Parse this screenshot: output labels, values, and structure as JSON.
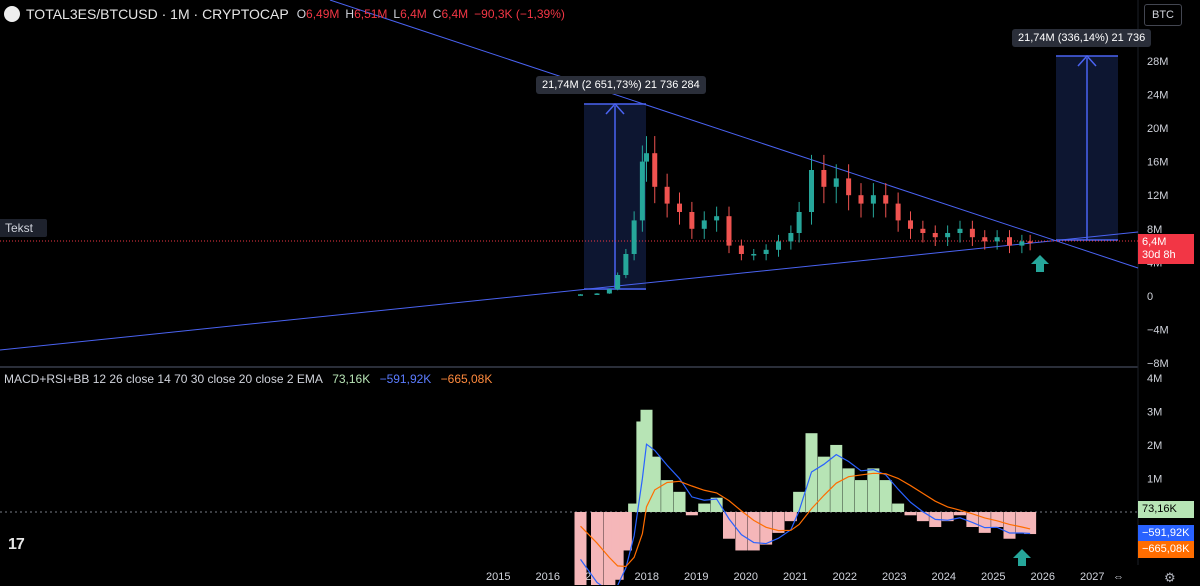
{
  "header": {
    "symbol": "TOTAL3ES/BTCUSD · 1M · CRYPTOCAP",
    "o_key": "O",
    "o_val": "6,49M",
    "h_key": "H",
    "h_val": "6,51M",
    "l_key": "L",
    "l_val": "6,4M",
    "c_key": "C",
    "c_val": "6,4M",
    "change": "−90,3K (−1,39%)"
  },
  "currency_button": "BTC",
  "drawing_label": "Tekst",
  "measure_left": "21,74M (2 651,73%) 21 736 284",
  "measure_right": "21,74M (336,14%) 21 736",
  "price_label": {
    "value": "6,4M",
    "countdown": "30d 8h"
  },
  "price_axis": [
    "28M",
    "24M",
    "20M",
    "16M",
    "12M",
    "8M",
    "4M",
    "0",
    "−4M",
    "−8M"
  ],
  "macd": {
    "name": "MACD+RSI+BB 12 26 close 14 70 30 close 20 close 2 EMA",
    "v1": "73,16K",
    "v2": "−591,92K",
    "v3": "−665,08K",
    "axis": [
      "4M",
      "3M",
      "2M",
      "1M"
    ]
  },
  "time_axis": [
    "2015",
    "2016",
    "2017",
    "2018",
    "2019",
    "2020",
    "2021",
    "2022",
    "2023",
    "2024",
    "2025",
    "2026",
    "2027"
  ],
  "range_icon": "calendar-range-icon",
  "settings_icon": "gear-icon",
  "logo": "tradingview-logo",
  "colors": {
    "up": "#26a69a",
    "down": "#ef5350",
    "trend": "#4a63f2",
    "macd_line": "#2962ff",
    "signal_line": "#ff6d00",
    "hist_up": "#b7e4b5",
    "hist_down": "#f5b7b9",
    "price": "#f23645"
  },
  "chart_data": {
    "type": "candlestick",
    "series": [
      {
        "name": "TOTAL3ES/BTCUSD",
        "x": [
          "2016-09",
          "2017-01",
          "2017-04",
          "2017-06",
          "2017-08",
          "2017-10",
          "2017-12",
          "2018-01",
          "2018-03",
          "2018-06",
          "2018-09",
          "2018-12",
          "2019-03",
          "2019-06",
          "2019-09",
          "2019-12",
          "2020-03",
          "2020-06",
          "2020-09",
          "2020-12",
          "2021-02",
          "2021-05",
          "2021-08",
          "2021-11",
          "2022-02",
          "2022-05",
          "2022-08",
          "2022-11",
          "2023-02",
          "2023-05",
          "2023-08",
          "2023-11",
          "2024-02",
          "2024-05",
          "2024-08",
          "2024-11",
          "2025-02",
          "2025-05",
          "2025-08",
          "2025-10"
        ],
        "close": [
          0.2,
          0.3,
          0.8,
          2.5,
          5,
          9,
          16,
          17,
          13,
          11,
          10,
          8,
          9,
          9.5,
          6,
          5,
          5,
          5.5,
          6.5,
          7.5,
          10,
          15,
          13,
          14,
          12,
          11,
          12,
          11,
          9,
          8,
          7.5,
          7,
          7.5,
          8,
          7,
          6.5,
          7,
          6,
          6.5,
          6.4
        ]
      }
    ],
    "ylim": [
      -8,
      30
    ]
  }
}
